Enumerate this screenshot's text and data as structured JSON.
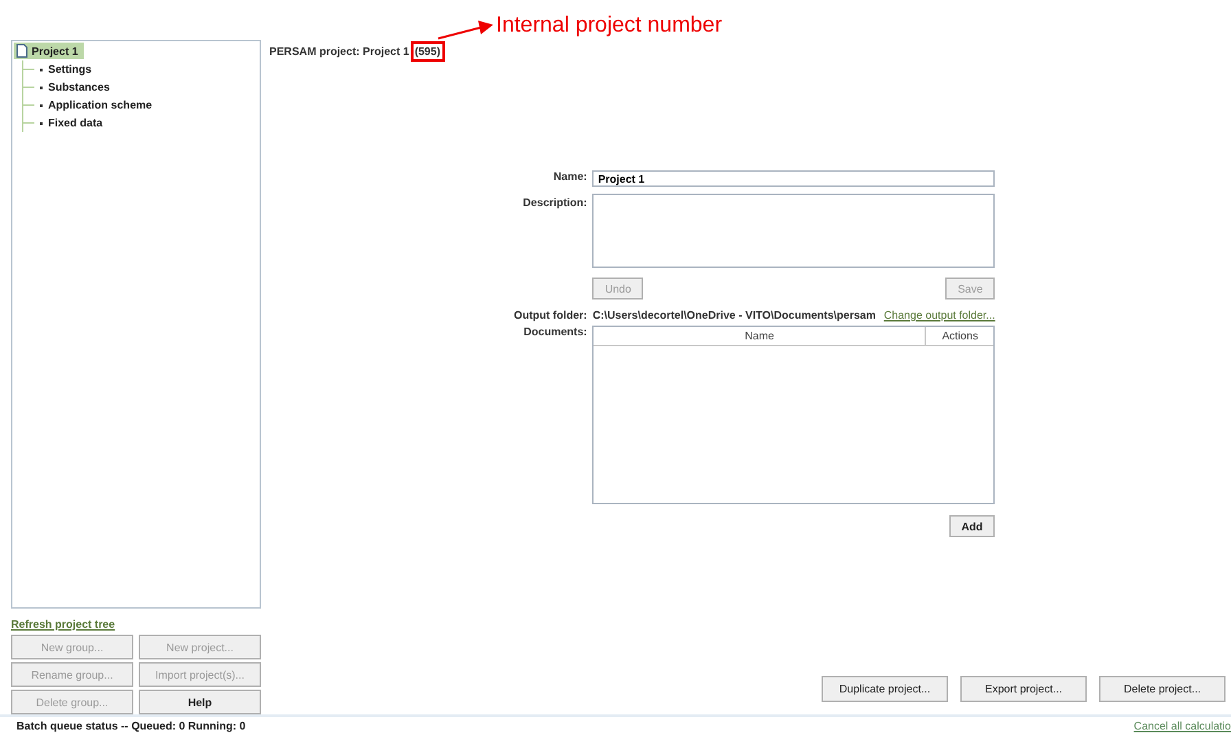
{
  "tree": {
    "label": "Project 1",
    "selected": true,
    "children": [
      {
        "label": "Settings",
        "selected": false
      },
      {
        "label": "Substances",
        "selected": false
      },
      {
        "label": "Application scheme",
        "selected": false
      },
      {
        "label": "Fixed data",
        "selected": false
      }
    ]
  },
  "refresh_link": "Refresh project tree",
  "left_buttons": [
    {
      "label": "New group...",
      "disabled": true
    },
    {
      "label": "New project...",
      "disabled": true
    },
    {
      "label": "Rename group...",
      "disabled": true
    },
    {
      "label": "Import project(s)...",
      "disabled": true
    },
    {
      "label": "Delete group...",
      "disabled": true
    },
    {
      "label": "Help",
      "disabled": false
    }
  ],
  "header": {
    "text": "PERSAM project: Project 1",
    "number": "(595)"
  },
  "annotation": {
    "text": "Internal project number"
  },
  "form": {
    "name_label": "Name:",
    "name_value": "Project 1",
    "description_label": "Description:",
    "undo": {
      "label": "Undo",
      "disabled": true
    },
    "save": {
      "label": "Save",
      "disabled": true
    },
    "output_label": "Output folder:",
    "output_path": "C:\\Users\\decortel\\OneDrive - VITO\\Documents\\persam",
    "output_link": "Change output folder...",
    "documents_label": "Documents:",
    "columns": [
      "Name",
      "Actions"
    ],
    "add": "Add"
  },
  "bottom_buttons": [
    "Duplicate project...",
    "Export project...",
    "Delete project..."
  ],
  "status_bar": {
    "text": "Batch queue status -- Queued: 0  Running: 0",
    "cancel_link": "Cancel all calculatio"
  }
}
